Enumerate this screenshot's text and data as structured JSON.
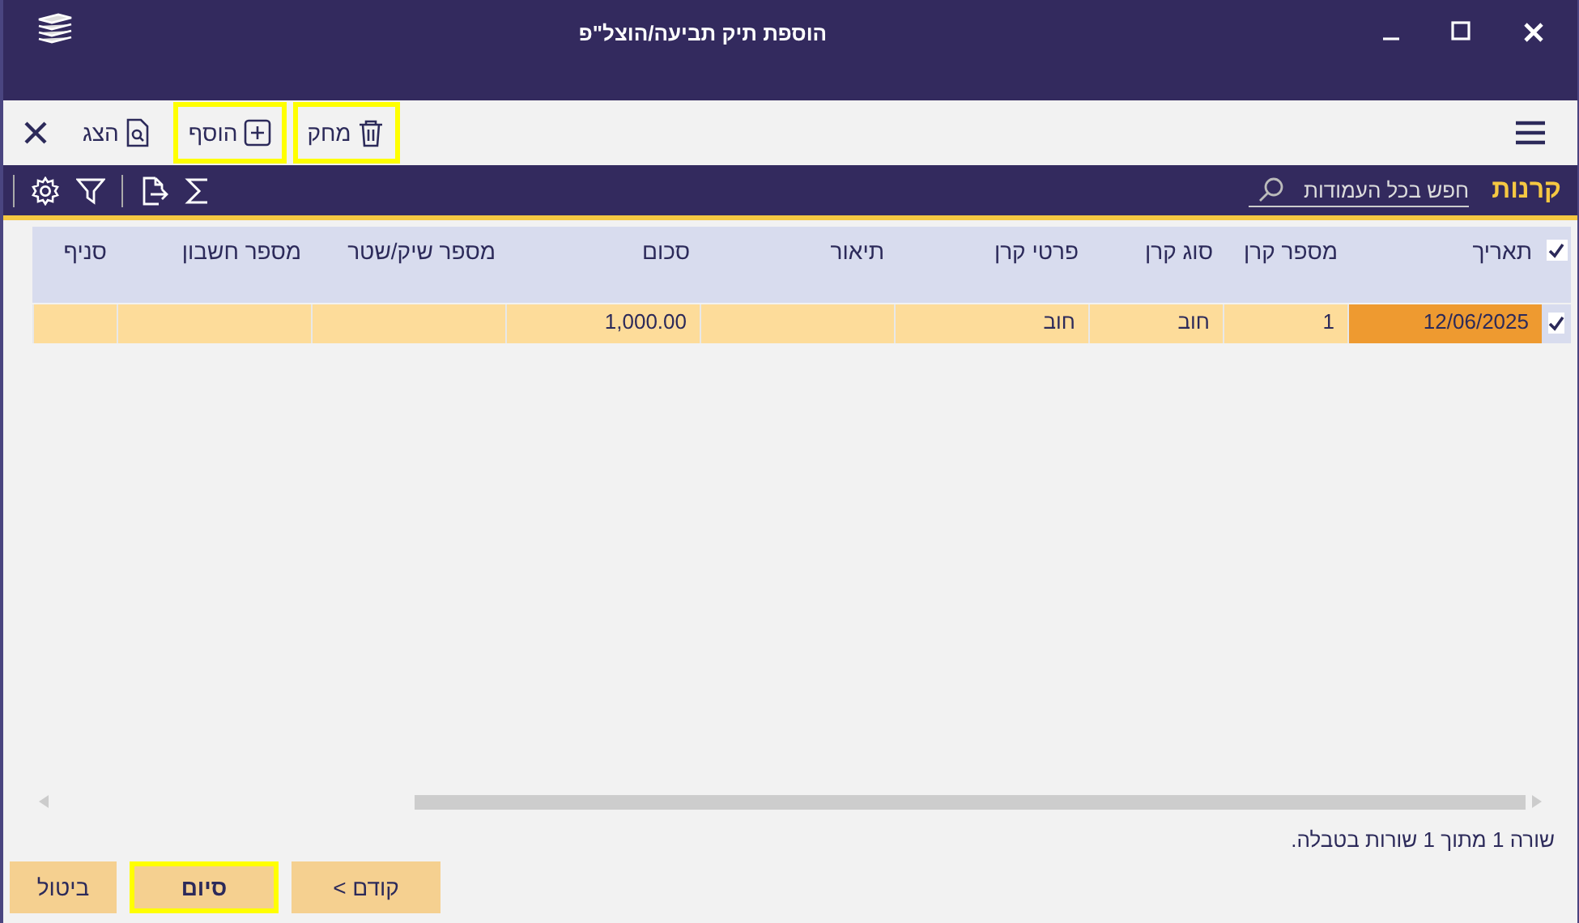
{
  "window": {
    "title": "הוספת תיק תביעה/הוצל\"פ"
  },
  "toolbar": {
    "buttons": [
      {
        "kind": "delete",
        "label": "מחק",
        "highlighted": true
      },
      {
        "kind": "add",
        "label": "הוסף",
        "highlighted": true
      },
      {
        "kind": "view",
        "label": "הצג",
        "highlighted": false
      },
      {
        "kind": "close",
        "highlighted": false
      }
    ]
  },
  "grid": {
    "title": "קרנות",
    "search": {
      "placeholder": "חפש בכל העמודות"
    },
    "columns": [
      "תאריך",
      "מספר קרן",
      "סוג קרן",
      "פרטי קרן",
      "תיאור",
      "סכום",
      "מספר שיק/שטר",
      "מספר חשבון",
      "סניף"
    ],
    "all_checked": true,
    "rows": [
      {
        "checked": true,
        "selected": true,
        "cells": [
          {
            "text": "12/06/2025",
            "focused": true
          },
          {
            "text": "1",
            "focused": false
          },
          {
            "text": "חוב",
            "focused": false
          },
          {
            "text": "חוב",
            "focused": false
          },
          {
            "focused": false
          },
          {
            "text": "1,000.00",
            "focused": false
          },
          {
            "focused": false
          },
          {
            "focused": false
          },
          {
            "focused": false
          }
        ]
      }
    ]
  },
  "status_text": "שורה 1 מתוך 1 שורות בטבלה.",
  "footer_buttons": [
    {
      "label": "< קודם",
      "highlighted": false
    },
    {
      "label": "סיום",
      "highlighted": true
    },
    {
      "label": "ביטול",
      "highlighted": false
    }
  ]
}
